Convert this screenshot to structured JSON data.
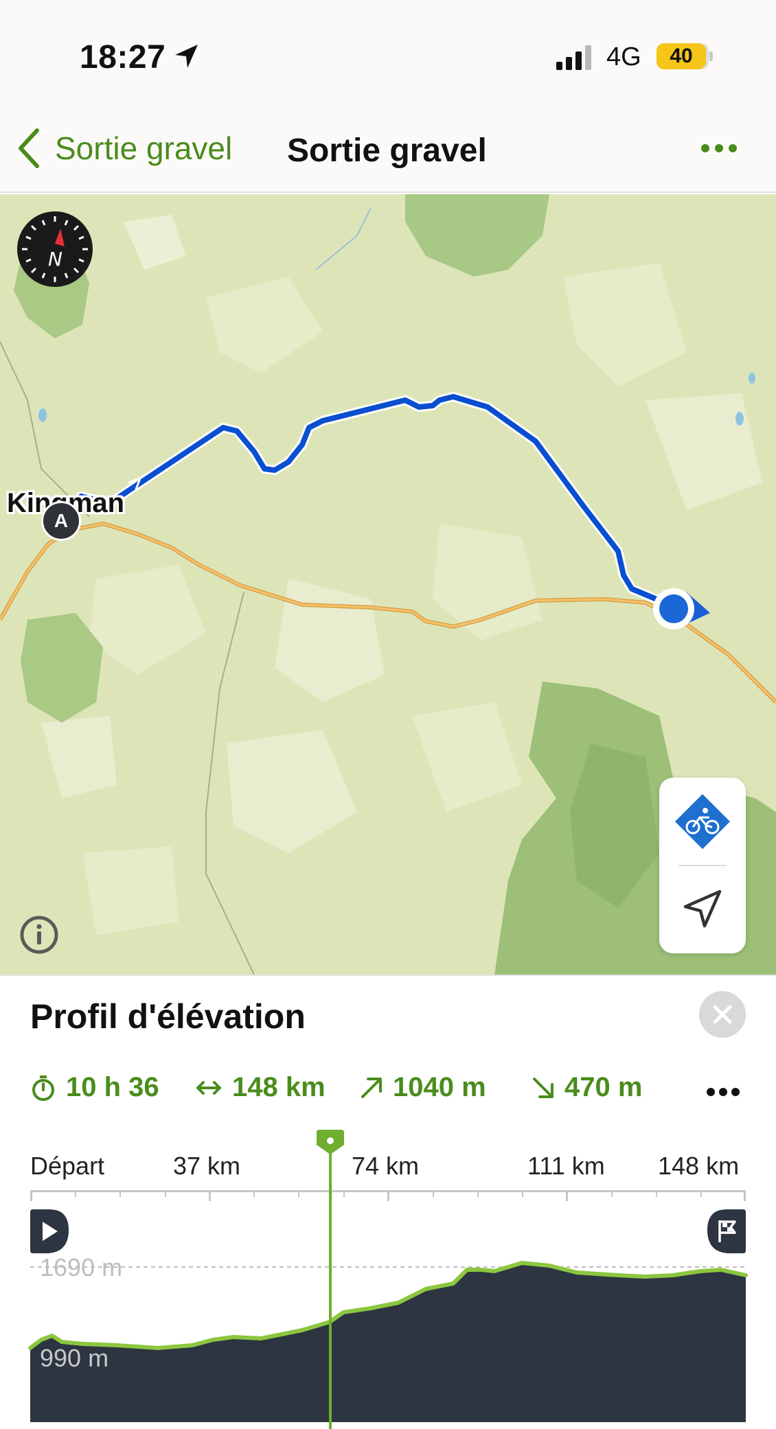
{
  "status_bar": {
    "time": "18:27",
    "network": "4G",
    "battery": "40"
  },
  "nav": {
    "back_label": "Sortie gravel",
    "title": "Sortie gravel"
  },
  "map": {
    "town_label": "Kingman",
    "start_marker": "A",
    "compass_letter": "N",
    "route_color": "#0a4fd0",
    "road_color": "#f0a030"
  },
  "panel": {
    "title": "Profil d'élévation",
    "stats": {
      "duration": "10 h 36",
      "distance": "148 km",
      "ascent": "1040 m",
      "descent": "470 m"
    },
    "axis_ticks": [
      "Départ",
      "37 km",
      "74 km",
      "111 km",
      "148 km"
    ],
    "elevation_labels": {
      "max": "1690 m",
      "min": "990 m"
    },
    "cursor_position_km": 62
  },
  "colors": {
    "accent": "#4a8c1c",
    "profile_fill": "#2c3541",
    "profile_line": "#8cc63f"
  }
}
